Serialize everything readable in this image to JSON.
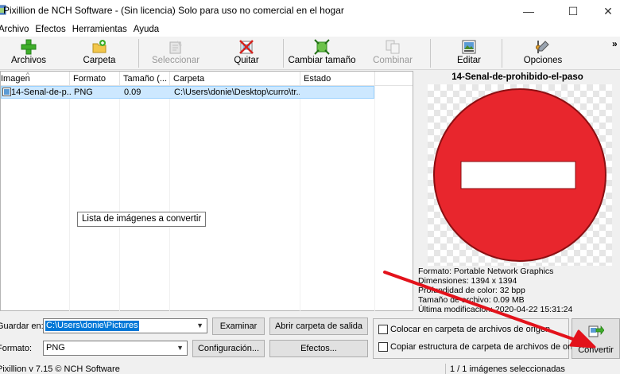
{
  "window": {
    "title": "Pixillion de NCH Software - (Sin licencia) Solo para uso no comercial en el hogar",
    "minimize_glyph": "—",
    "maximize_glyph": "☐",
    "close_glyph": "✕"
  },
  "menu": [
    "Archivo",
    "Efectos",
    "Herramientas",
    "Ayuda"
  ],
  "toolbar": {
    "items": [
      {
        "label": "Archivos",
        "icon": "add-files-icon",
        "enabled": true
      },
      {
        "label": "Carpeta",
        "icon": "add-folder-icon",
        "enabled": true
      },
      {
        "label": "Seleccionar",
        "icon": "select-icon",
        "enabled": false
      },
      {
        "label": "Quitar",
        "icon": "remove-icon",
        "enabled": true
      },
      {
        "label": "Cambiar tamaño",
        "icon": "resize-icon",
        "enabled": true
      },
      {
        "label": "Combinar",
        "icon": "combine-icon",
        "enabled": false
      },
      {
        "label": "Editar",
        "icon": "edit-icon",
        "enabled": true
      },
      {
        "label": "Opciones",
        "icon": "options-icon",
        "enabled": true
      }
    ],
    "more_glyph": "»"
  },
  "file_list": {
    "columns": [
      "Imagen",
      "Formato",
      "Tamaño (...",
      "Carpeta",
      "Estado"
    ],
    "sort_glyph": "^",
    "rows": [
      {
        "imagen": "14-Senal-de-p...",
        "formato": "PNG",
        "tamano": "0.09",
        "carpeta": "C:\\Users\\donie\\Desktop\\curro\\tr...",
        "estado": ""
      }
    ],
    "tooltip": "Lista de imágenes a convertir"
  },
  "preview": {
    "title": "14-Senal-de-prohibido-el-paso",
    "info": [
      "Formato: Portable Network Graphics",
      "Dimensiones: 1394 x 1394",
      "Profundidad de color: 32 bpp",
      "Tamaño de archivo: 0.09 MB",
      "Última modificación: 2020-04-22 15:31:24"
    ]
  },
  "output": {
    "save_label": "Guardar en:",
    "save_path": "C:\\Users\\donie\\Pictures",
    "browse_button": "Examinar",
    "open_folder_button": "Abrir carpeta de salida",
    "format_label": "Formato:",
    "format_value": "PNG",
    "config_button": "Configuración...",
    "effects_button": "Efectos...",
    "checkbox_source_folder": "Colocar en carpeta de archivos de origen",
    "checkbox_copy_structure": "Copiar estructura de carpeta de archivos de origen",
    "convert_button": "Convertir"
  },
  "status": {
    "version": "Pixillion v 7.15 © NCH Software",
    "selection": "1 / 1 imágenes seleccionadas"
  },
  "colors": {
    "selection_row": "#cde8ff",
    "sign_red": "#e8262d",
    "annotation_arrow": "#e3121b",
    "accent_select": "#0078d7"
  }
}
